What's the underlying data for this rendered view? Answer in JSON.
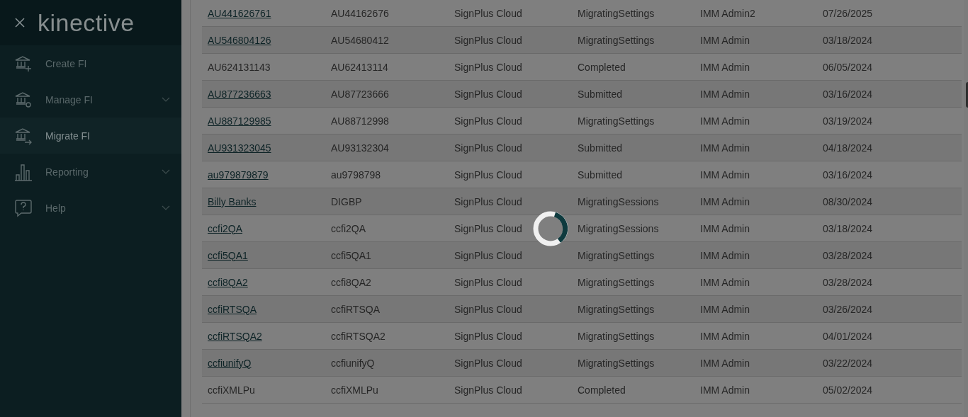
{
  "sidebar": {
    "logo": "kinective",
    "items": [
      {
        "label": "Create FI",
        "selected": false,
        "expandable": false
      },
      {
        "label": "Manage FI",
        "selected": false,
        "expandable": true
      },
      {
        "label": "Migrate FI",
        "selected": true,
        "expandable": false
      },
      {
        "label": "Reporting",
        "selected": false,
        "expandable": true
      },
      {
        "label": "Help",
        "selected": false,
        "expandable": true
      }
    ]
  },
  "loading": true,
  "table": {
    "rows": [
      {
        "link": true,
        "cells": [
          "AU441626761",
          "AU44162676",
          "SignPlus Cloud",
          "MigratingSettings",
          "IMM Admin2",
          "07/26/2025"
        ]
      },
      {
        "link": true,
        "cells": [
          "AU546804126",
          "AU54680412",
          "SignPlus Cloud",
          "MigratingSettings",
          "IMM Admin",
          "03/18/2024"
        ]
      },
      {
        "link": false,
        "cells": [
          "AU624131143",
          "AU62413114",
          "SignPlus Cloud",
          "Completed",
          "IMM Admin",
          "06/05/2024"
        ]
      },
      {
        "link": true,
        "cells": [
          "AU877236663",
          "AU87723666",
          "SignPlus Cloud",
          "Submitted",
          "IMM Admin",
          "03/16/2024"
        ]
      },
      {
        "link": true,
        "cells": [
          "AU887129985",
          "AU88712998",
          "SignPlus Cloud",
          "MigratingSettings",
          "IMM Admin",
          "03/19/2024"
        ]
      },
      {
        "link": true,
        "cells": [
          "AU931323045",
          "AU93132304",
          "SignPlus Cloud",
          "Submitted",
          "IMM Admin",
          "04/18/2024"
        ]
      },
      {
        "link": true,
        "cells": [
          "au979879879",
          "au9798798",
          "SignPlus Cloud",
          "Submitted",
          "IMM Admin",
          "03/16/2024"
        ]
      },
      {
        "link": true,
        "cells": [
          "Billy Banks",
          "DIGBP",
          "SignPlus Cloud",
          "MigratingSessions",
          "IMM Admin",
          "08/30/2024"
        ]
      },
      {
        "link": true,
        "cells": [
          "ccfi2QA",
          "ccfi2QA",
          "SignPlus Cloud",
          "MigratingSessions",
          "IMM Admin",
          "03/18/2024"
        ]
      },
      {
        "link": true,
        "cells": [
          "ccfi5QA1",
          "ccfi5QA1",
          "SignPlus Cloud",
          "MigratingSettings",
          "IMM Admin",
          "03/28/2024"
        ]
      },
      {
        "link": true,
        "cells": [
          "ccfi8QA2",
          "ccfi8QA2",
          "SignPlus Cloud",
          "MigratingSettings",
          "IMM Admin",
          "03/28/2024"
        ]
      },
      {
        "link": true,
        "cells": [
          "ccfiRTSQA",
          "ccfiRTSQA",
          "SignPlus Cloud",
          "MigratingSettings",
          "IMM Admin",
          "03/26/2024"
        ]
      },
      {
        "link": true,
        "cells": [
          "ccfiRTSQA2",
          "ccfiRTSQA2",
          "SignPlus Cloud",
          "MigratingSettings",
          "IMM Admin",
          "04/01/2024"
        ]
      },
      {
        "link": true,
        "cells": [
          "ccfiunifyQ",
          "ccfiunifyQ",
          "SignPlus Cloud",
          "MigratingSettings",
          "IMM Admin",
          "03/22/2024"
        ]
      },
      {
        "link": false,
        "cells": [
          "ccfiXMLPu",
          "ccfiXMLPu",
          "SignPlus Cloud",
          "Completed",
          "IMM Admin",
          "05/02/2024"
        ]
      }
    ]
  }
}
